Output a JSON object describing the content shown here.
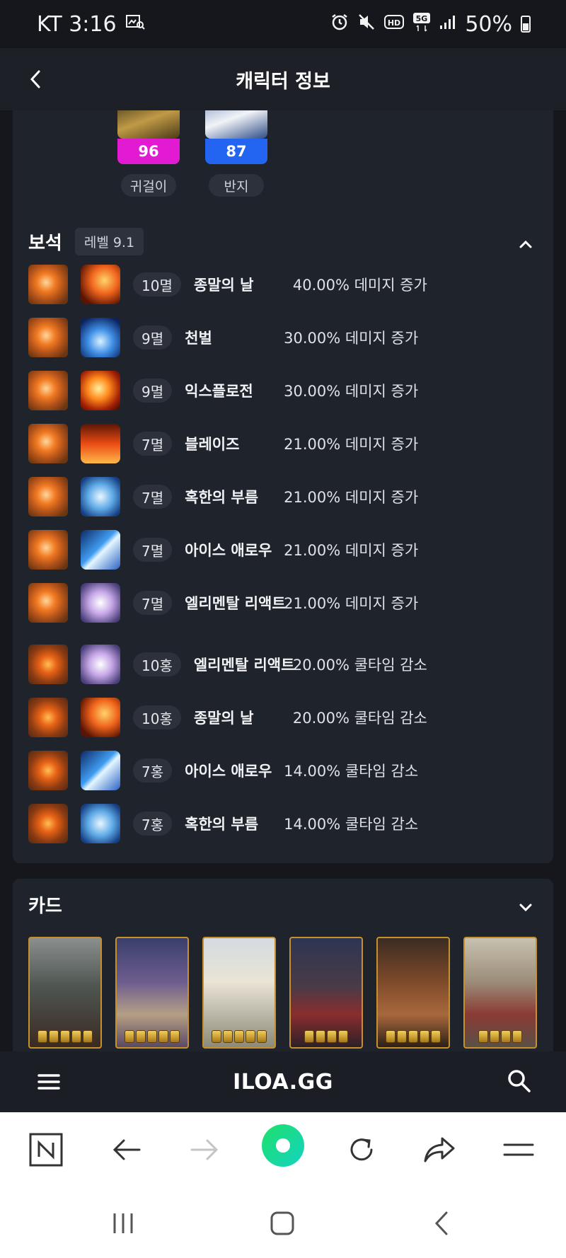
{
  "status_bar": {
    "carrier_time": "KT 3:16",
    "battery": "50%",
    "network": "5G"
  },
  "header": {
    "title": "캐릭터 정보"
  },
  "accessories": [
    {
      "value": "96",
      "label": "귀걸이",
      "color": "#e21ad2"
    },
    {
      "value": "87",
      "label": "반지",
      "color": "#2364f1"
    }
  ],
  "gems": {
    "title": "보석",
    "level_badge": "레벨 9.1",
    "items": [
      {
        "level": "10멸",
        "skill": "종말의 날",
        "effect": "40.00% 데미지 증가",
        "gem_type": "damage",
        "skill_icon": "flame-meteor"
      },
      {
        "level": "9멸",
        "skill": "천벌",
        "effect": "30.00% 데미지 증가",
        "gem_type": "damage",
        "skill_icon": "lightning-bolt"
      },
      {
        "level": "9멸",
        "skill": "익스플로전",
        "effect": "30.00% 데미지 증가",
        "gem_type": "damage",
        "skill_icon": "fire-orb"
      },
      {
        "level": "7멸",
        "skill": "블레이즈",
        "effect": "21.00% 데미지 증가",
        "gem_type": "damage",
        "skill_icon": "fire-wall"
      },
      {
        "level": "7멸",
        "skill": "혹한의 부름",
        "effect": "21.00% 데미지 증가",
        "gem_type": "damage",
        "skill_icon": "snowflake"
      },
      {
        "level": "7멸",
        "skill": "아이스 애로우",
        "effect": "21.00% 데미지 증가",
        "gem_type": "damage",
        "skill_icon": "ice-arrow"
      },
      {
        "level": "7멸",
        "skill": "엘리멘탈 리액트",
        "effect": "21.00% 데미지 증가",
        "gem_type": "damage",
        "skill_icon": "crystal"
      },
      {
        "level": "10홍",
        "skill": "엘리멘탈 리액트",
        "effect": "20.00% 쿨타임 감소",
        "gem_type": "cooldown",
        "skill_icon": "crystal"
      },
      {
        "level": "10홍",
        "skill": "종말의 날",
        "effect": "20.00% 쿨타임 감소",
        "gem_type": "cooldown",
        "skill_icon": "flame-meteor"
      },
      {
        "level": "7홍",
        "skill": "아이스 애로우",
        "effect": "14.00% 쿨타임 감소",
        "gem_type": "cooldown",
        "skill_icon": "ice-arrow"
      },
      {
        "level": "7홍",
        "skill": "혹한의 부름",
        "effect": "14.00% 쿨타임 감소",
        "gem_type": "cooldown",
        "skill_icon": "snowflake"
      }
    ]
  },
  "cards": {
    "title": "카드",
    "count_shown": 6
  },
  "site_bar": {
    "logo": "ILOA.GG"
  },
  "browser_bar": {
    "buttons": [
      "naver-home",
      "back",
      "forward",
      "green-dot",
      "reload",
      "share",
      "menu"
    ]
  }
}
